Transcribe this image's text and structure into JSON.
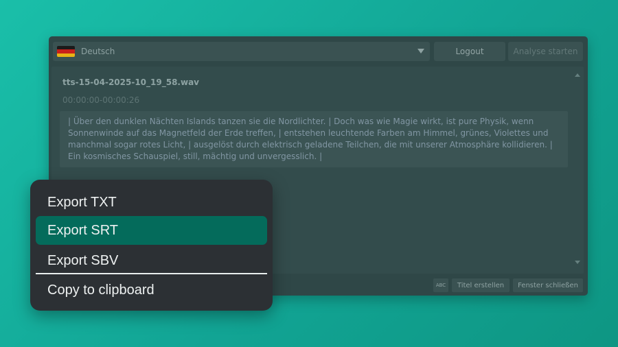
{
  "toolbar": {
    "language": "Deutsch",
    "logout_label": "Logout",
    "analyse_label": "Analyse starten"
  },
  "file": {
    "name": "tts-15-04-2025-10_19_58.wav",
    "time_range": "00:00:00-00:00:26",
    "transcript": "| Über den dunklen Nächten Islands tanzen sie die Nordlichter. | Doch was wie Magie wirkt, ist pure Physik, wenn Sonnenwinde auf das Magnetfeld der Erde treffen, | entstehen leuchtende Farben am Himmel, grünes, Violettes und manchmal sogar rotes Licht, | ausgelöst durch elektrisch geladene Teilchen, die mit unserer Atmosphäre kollidieren. | Ein kosmisches Schauspiel, still, mächtig und unvergesslich. |"
  },
  "bottom_bar": {
    "abc_label": "ABC",
    "titel_label": "Titel erstellen",
    "fenster_label": "Fenster schließen"
  },
  "context_menu": {
    "items": [
      {
        "label": "Export TXT"
      },
      {
        "label": "Export SRT",
        "selected": true
      },
      {
        "label": "Export SBV"
      },
      {
        "label": "Copy to clipboard"
      }
    ]
  },
  "colors": {
    "accent": "#046b5b",
    "menu_background": "#2c3034",
    "window_background": "#2f4747"
  },
  "icons": {
    "flag": "germany-flag-icon",
    "dropdown": "chevron-down-icon",
    "scroll_up": "scroll-up-icon",
    "scroll_down": "scroll-down-icon",
    "spellcheck": "abc-icon"
  }
}
